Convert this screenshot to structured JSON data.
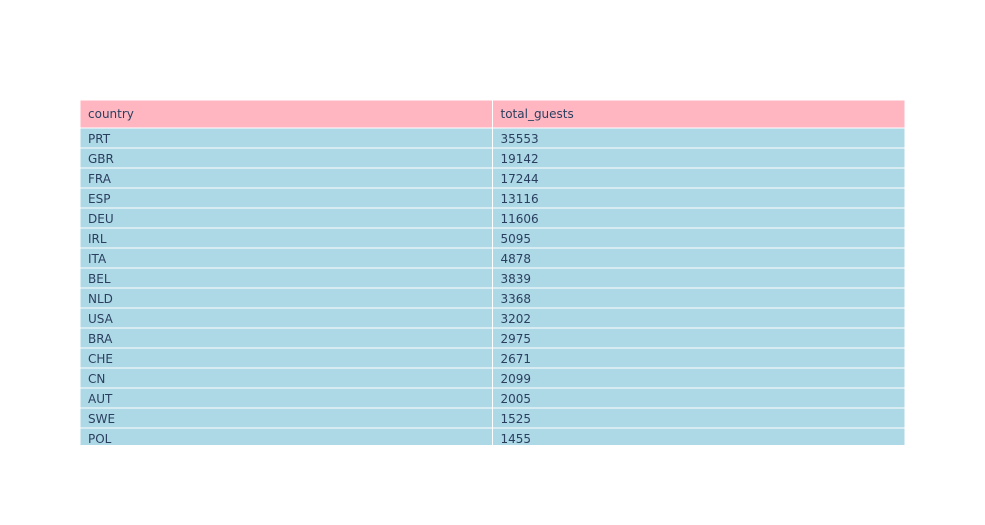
{
  "chart_data": {
    "type": "table",
    "columns": [
      "country",
      "total_guests"
    ],
    "rows": [
      [
        "PRT",
        35553
      ],
      [
        "GBR",
        19142
      ],
      [
        "FRA",
        17244
      ],
      [
        "ESP",
        13116
      ],
      [
        "DEU",
        11606
      ],
      [
        "IRL",
        5095
      ],
      [
        "ITA",
        4878
      ],
      [
        "BEL",
        3839
      ],
      [
        "NLD",
        3368
      ],
      [
        "USA",
        3202
      ],
      [
        "BRA",
        2975
      ],
      [
        "CHE",
        2671
      ],
      [
        "CN",
        2099
      ],
      [
        "AUT",
        2005
      ],
      [
        "SWE",
        1525
      ],
      [
        "POL",
        1455
      ]
    ],
    "header_color": "#ffb6c1",
    "cell_color": "#add8e6",
    "line_color": "#ffffff",
    "text_color": "#2a3f5f"
  }
}
